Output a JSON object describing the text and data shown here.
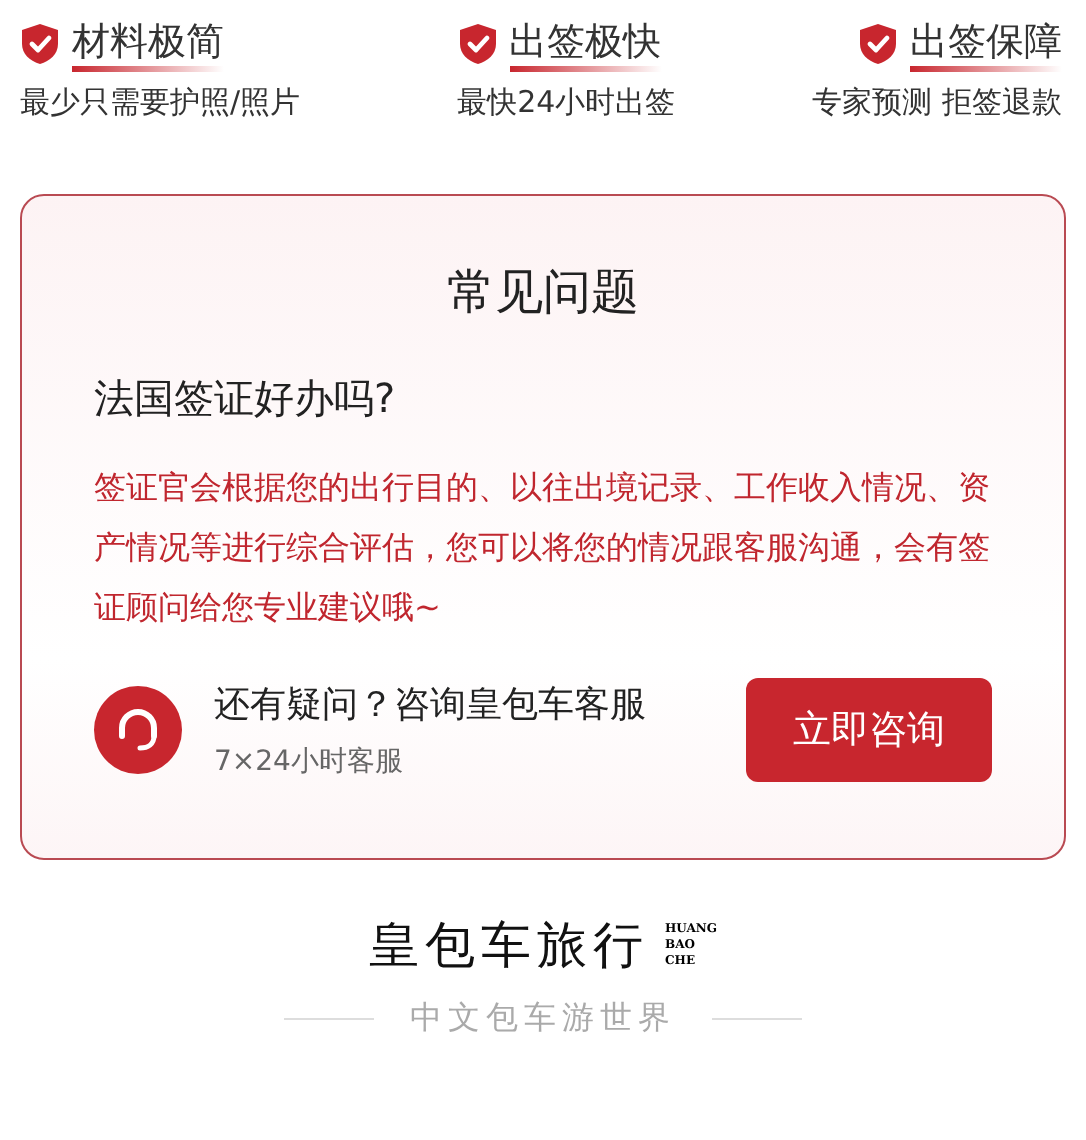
{
  "features": [
    {
      "title": "材料极简",
      "subtitle": "最少只需要护照/照片"
    },
    {
      "title": "出签极快",
      "subtitle": "最快24小时出签"
    },
    {
      "title": "出签保障",
      "subtitle": "专家预测 拒签退款"
    }
  ],
  "faq": {
    "heading": "常见问题",
    "question": "法国签证好办吗?",
    "answer": "签证官会根据您的出行目的、以往出境记录、工作收入情况、资产情况等进行综合评估，您可以将您的情况跟客服沟通，会有签证顾问给您专业建议哦~",
    "contact": {
      "title": "还有疑问？咨询皇包车客服",
      "hours": "7×24小时客服",
      "button": "立即咨询"
    }
  },
  "footer": {
    "brand": "皇包车旅行",
    "brand_latin": [
      "HUANG",
      "BAO",
      "CHE"
    ],
    "slogan": "中文包车游世界"
  }
}
